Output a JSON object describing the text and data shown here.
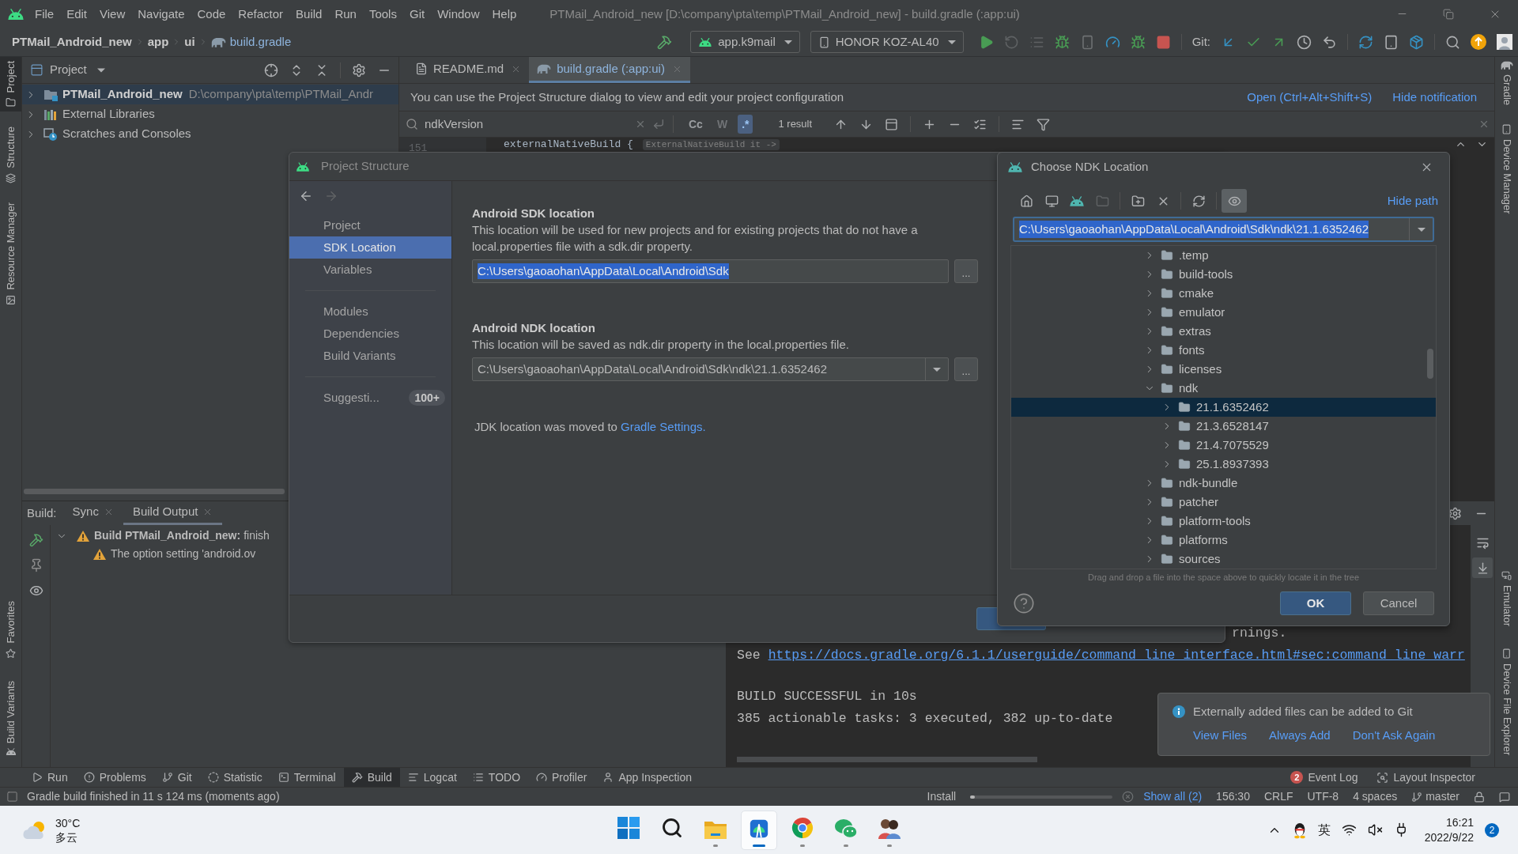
{
  "menu_bar": {
    "items": [
      "File",
      "Edit",
      "View",
      "Navigate",
      "Code",
      "Refactor",
      "Build",
      "Run",
      "Tools",
      "Git",
      "Window",
      "Help"
    ],
    "title": "PTMail_Android_new [D:\\company\\pta\\temp\\PTMail_Android_new] - build.gradle (:app:ui)"
  },
  "nav_bar": {
    "breadcrumbs": [
      {
        "label": "PTMail_Android_new",
        "kind": "folder"
      },
      {
        "label": "app",
        "kind": "folder"
      },
      {
        "label": "ui",
        "kind": "folder"
      },
      {
        "label": "build.gradle",
        "kind": "gradle"
      }
    ],
    "run_config": "app.k9mail",
    "device": "HONOR KOZ-AL40",
    "git_label": "Git:"
  },
  "left_strip": {
    "top": [
      {
        "label": "Project",
        "kind": "folder",
        "selected": true
      },
      {
        "label": "Structure",
        "kind": "structure",
        "selected": false
      },
      {
        "label": "Resource Manager",
        "kind": "resources",
        "selected": false
      }
    ],
    "bottom": [
      {
        "label": "Favorites",
        "kind": "star",
        "selected": false
      },
      {
        "label": "Build Variants",
        "kind": "android",
        "selected": false
      }
    ]
  },
  "right_strip": {
    "top": [
      {
        "label": "Gradle",
        "kind": "gradle",
        "selected": false
      },
      {
        "label": "Device Manager",
        "kind": "device",
        "selected": false
      }
    ],
    "bottom": [
      {
        "label": "Emulator",
        "kind": "emulator",
        "selected": false
      },
      {
        "label": "Device File Explorer",
        "kind": "phone",
        "selected": false
      }
    ]
  },
  "project_panel": {
    "title": "Project",
    "tree": [
      {
        "label": "PTMail_Android_new",
        "path": "D:\\company\\pta\\temp\\PTMail_Andr",
        "kind": "module",
        "selected": true,
        "expanded": false
      },
      {
        "label": "External Libraries",
        "kind": "libraries",
        "selected": false,
        "expanded": false
      },
      {
        "label": "Scratches and Consoles",
        "kind": "scratches",
        "selected": false,
        "expanded": false
      }
    ]
  },
  "editor": {
    "tabs": [
      {
        "label": "README.md",
        "kind": "markdown",
        "selected": false
      },
      {
        "label": "build.gradle (:app:ui)",
        "kind": "gradle",
        "selected": true
      }
    ],
    "notification": {
      "text": "You can use the Project Structure dialog to view and edit your project configuration",
      "links": [
        "Open (Ctrl+Alt+Shift+S)",
        "Hide notification"
      ]
    },
    "search": {
      "value": "ndkVersion",
      "options": [
        {
          "label": "Cc",
          "selected": false,
          "disabled": false
        },
        {
          "label": "W",
          "selected": false,
          "disabled": true
        },
        {
          "label": ".*",
          "selected": true,
          "disabled": false
        }
      ],
      "result": "1 result"
    },
    "code": {
      "line_number": "151",
      "text": "externalNativeBuild {",
      "hint": "ExternalNativeBuild it ->"
    }
  },
  "build_panel": {
    "label": "Build:",
    "tabs": [
      {
        "label": "Sync",
        "selected": false
      },
      {
        "label": "Build Output",
        "selected": true
      }
    ],
    "tree": [
      {
        "title": "Build PTMail_Android_new:",
        "text": "finish",
        "kind": "warning",
        "expanded": true,
        "children": [
          {
            "text": "The option setting 'android.ov",
            "kind": "warning"
          }
        ]
      }
    ],
    "console": [
      {
        "lines": [
          {
            "kind": "fragment",
            "text": "rnings."
          },
          {
            "kind": "link",
            "text": "See",
            "link": "https://docs.gradle.org/6.1.1/userguide/command_line_interface.html#sec:command_line_warr"
          }
        ]
      },
      {
        "lines": [
          {
            "kind": "text",
            "text": "BUILD SUCCESSFUL in 10s"
          },
          {
            "kind": "text",
            "text": "385 actionable tasks: 3 executed, 382 up-to-date"
          }
        ]
      }
    ],
    "toggles": [
      {
        "kind": "wrap",
        "selected": false
      },
      {
        "kind": "scroll_end",
        "selected": true
      }
    ]
  },
  "tool_tabs": {
    "left": [
      {
        "label": "Run",
        "kind": "run",
        "selected": false
      },
      {
        "label": "Problems",
        "kind": "problems",
        "selected": false
      },
      {
        "label": "Git",
        "kind": "git",
        "selected": false
      },
      {
        "label": "Statistic",
        "kind": "statistic",
        "selected": false
      },
      {
        "label": "Terminal",
        "kind": "terminal",
        "selected": false
      },
      {
        "label": "Build",
        "kind": "build",
        "selected": true
      },
      {
        "label": "Logcat",
        "kind": "logcat",
        "selected": false
      },
      {
        "label": "TODO",
        "kind": "todo",
        "selected": false
      },
      {
        "label": "Profiler",
        "kind": "profiler",
        "selected": false
      },
      {
        "label": "App Inspection",
        "kind": "inspection",
        "selected": false
      }
    ],
    "right": [
      {
        "label": "Event Log",
        "kind": "event",
        "badge": "2"
      },
      {
        "label": "Layout Inspector",
        "kind": "layout"
      }
    ]
  },
  "status_bar": {
    "message": "Gradle build finished in 11 s 124 ms (moments ago)",
    "task": "Install",
    "level": 0.03,
    "show_all": "Show all (2)",
    "items": [
      "156:30",
      "CRLF",
      "UTF-8",
      "4 spaces"
    ],
    "branch": "master"
  },
  "project_structure": {
    "title": "Project Structure",
    "arrows": [
      {
        "kind": "back",
        "disabled": false
      },
      {
        "kind": "forward",
        "disabled": true
      }
    ],
    "nav_groups": [
      {
        "items": [
          {
            "label": "Project",
            "selected": false
          },
          {
            "label": "SDK Location",
            "selected": true
          },
          {
            "label": "Variables",
            "selected": false
          }
        ]
      },
      {
        "items": [
          {
            "label": "Modules",
            "selected": false
          },
          {
            "label": "Dependencies",
            "selected": false
          },
          {
            "label": "Build Variants",
            "selected": false
          }
        ]
      },
      {
        "items": [
          {
            "label": "Suggesti...",
            "badge": "100+",
            "selected": false
          }
        ]
      }
    ],
    "sections": [
      {
        "heading": "Android SDK location",
        "description": "This location will be used for new projects and for existing projects that do not have a local.properties file with a sdk.dir property.",
        "value": "C:\\Users\\gaoaohan\\AppData\\Local\\Android\\Sdk",
        "value_selected": true,
        "kind": "text",
        "browse": "..."
      },
      {
        "heading": "Android NDK location",
        "description": "This location will be saved as ndk.dir property in the local.properties file.",
        "value": "C:\\Users\\gaoaohan\\AppData\\Local\\Android\\Sdk\\ndk\\21.1.6352462",
        "value_selected": false,
        "kind": "combo",
        "browse": "..."
      }
    ],
    "note": {
      "text": "JDK location was moved to",
      "link": "Gradle Settings."
    }
  },
  "ndk_chooser": {
    "title": "Choose NDK Location",
    "toolbar": [
      [
        {
          "kind": "home",
          "disabled": false,
          "selected": false
        },
        {
          "kind": "desktop",
          "disabled": false,
          "selected": false
        },
        {
          "kind": "android",
          "disabled": false,
          "selected": false
        },
        {
          "kind": "folder",
          "disabled": true,
          "selected": false
        }
      ],
      [
        {
          "kind": "new_folder",
          "disabled": false,
          "selected": false
        },
        {
          "kind": "delete",
          "disabled": false,
          "selected": false
        }
      ],
      [
        {
          "kind": "refresh",
          "disabled": false,
          "selected": false
        }
      ],
      [
        {
          "kind": "hidden",
          "disabled": false,
          "selected": true
        }
      ]
    ],
    "hide_path": "Hide path",
    "path": "C:\\Users\\gaoaohan\\AppData\\Local\\Android\\Sdk\\ndk\\21.1.6352462",
    "path_selected": true,
    "tree": [
      {
        "label": ".temp",
        "expanded": false,
        "selected": false
      },
      {
        "label": "build-tools",
        "expanded": false,
        "selected": false
      },
      {
        "label": "cmake",
        "expanded": false,
        "selected": false
      },
      {
        "label": "emulator",
        "expanded": false,
        "selected": false
      },
      {
        "label": "extras",
        "expanded": false,
        "selected": false
      },
      {
        "label": "fonts",
        "expanded": false,
        "selected": false
      },
      {
        "label": "licenses",
        "expanded": false,
        "selected": false
      },
      {
        "label": "ndk",
        "expanded": true,
        "selected": false,
        "children": [
          {
            "label": "21.1.6352462",
            "expanded": false,
            "selected": true
          },
          {
            "label": "21.3.6528147",
            "expanded": false,
            "selected": false
          },
          {
            "label": "21.4.7075529",
            "expanded": false,
            "selected": false
          },
          {
            "label": "25.1.8937393",
            "expanded": false,
            "selected": false
          }
        ]
      },
      {
        "label": "ndk-bundle",
        "expanded": false,
        "selected": false
      },
      {
        "label": "patcher",
        "expanded": false,
        "selected": false
      },
      {
        "label": "platform-tools",
        "expanded": false,
        "selected": false
      },
      {
        "label": "platforms",
        "expanded": false,
        "selected": false
      },
      {
        "label": "sources",
        "expanded": false,
        "selected": false
      }
    ],
    "hint": "Drag and drop a file into the space above to quickly locate it in the tree",
    "buttons": [
      {
        "label": "OK",
        "kind": "primary"
      },
      {
        "label": "Cancel",
        "kind": "secondary"
      }
    ]
  },
  "balloon": {
    "text": "Externally added files can be added to Git",
    "links": [
      "View Files",
      "Always Add",
      "Don't Ask Again"
    ]
  },
  "taskbar": {
    "weather": {
      "temperature": "30°C",
      "condition": "多云"
    },
    "apps": [
      {
        "kind": "start",
        "running": false,
        "selected": false
      },
      {
        "kind": "search",
        "running": false,
        "selected": false
      },
      {
        "kind": "explorer",
        "running": true,
        "selected": false
      },
      {
        "kind": "studio",
        "running": true,
        "selected": true
      },
      {
        "kind": "chrome",
        "running": true,
        "selected": false
      },
      {
        "kind": "wechat",
        "running": true,
        "selected": false
      },
      {
        "kind": "people",
        "running": true,
        "selected": false
      }
    ],
    "ime": "英",
    "time": "16:21",
    "date": "2022/9/22",
    "notifications": "2"
  }
}
